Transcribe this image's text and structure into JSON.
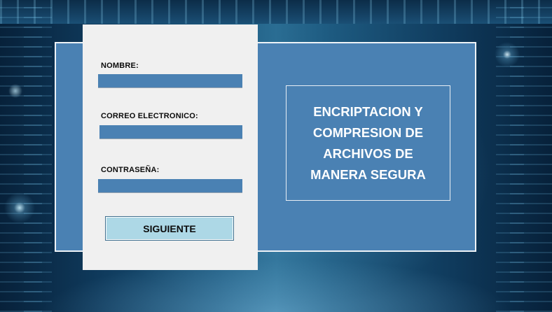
{
  "form": {
    "nombre_label": "NOMBRE:",
    "nombre_value": "",
    "correo_label": "CORREO ELECTRONICO:",
    "correo_value": "",
    "password_label": "CONTRASEÑA:",
    "password_value": "",
    "next_button_label": "SIGUIENTE"
  },
  "title": {
    "line1": "ENCRIPTACION Y",
    "line2": "COMPRESION DE",
    "line3": "ARCHIVOS DE",
    "line4": "MANERA SEGURA"
  },
  "colors": {
    "panel_blue": "#4a81b3",
    "form_bg": "#f0f0f0",
    "button_bg": "#add8e6",
    "title_text": "#ffffff"
  }
}
